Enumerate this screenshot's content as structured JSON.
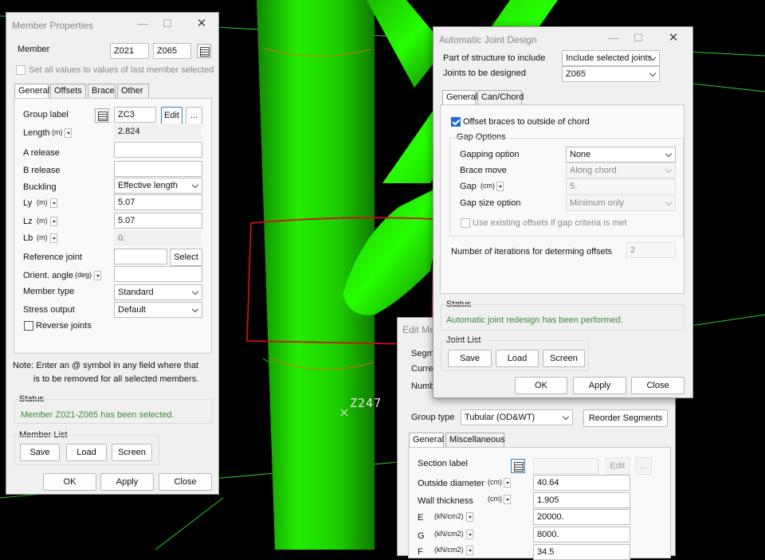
{
  "viewport": {
    "node_label": "Z247"
  },
  "member_properties": {
    "title": "Member Properties",
    "member_label": "Member",
    "member_from": "Z021",
    "member_to": "Z065",
    "set_all_label": "Set all values to values of last member selected",
    "tabs": [
      "General",
      "Offsets",
      "Brace",
      "Other"
    ],
    "group_label": "Group label",
    "group_value": "ZC3",
    "edit_label": "Edit",
    "more_label": "...",
    "length_label": "Length",
    "unit_m": "(m)",
    "unit_deg": "(deg)",
    "length_value": "2.824",
    "a_release": "A release",
    "b_release": "B release",
    "buckling_label": "Buckling",
    "buckling_value": "Effective length",
    "ly_label": "Ly",
    "ly_value": "5.07",
    "lz_label": "Lz",
    "lz_value": "5.07",
    "lb_label": "Lb",
    "lb_value": "0.",
    "ref_joint_label": "Reference joint",
    "select_label": "Select",
    "orient_label": "Orient. angle",
    "member_type_label": "Member type",
    "member_type_value": "Standard",
    "stress_output_label": "Stress output",
    "stress_output_value": "Default",
    "reverse_joints_label": "Reverse joints",
    "note_line1": "Note: Enter an @ symbol in any field where that",
    "note_line2": "is to be removed for all selected members.",
    "status_title": "Status",
    "status_text": "Member Z021-Z065 has been selected.",
    "member_list_title": "Member List",
    "save": "Save",
    "load": "Load",
    "screen": "Screen",
    "ok": "OK",
    "apply": "Apply",
    "close": "Close"
  },
  "edit_member": {
    "title_partial": "Edit Me",
    "seg_partial": "Segm",
    "curr_partial": "Curren",
    "numb_partial": "Numb",
    "group_type_label": "Group type",
    "group_type_value": "Tubular (OD&WT)",
    "reorder_label": "Reorder Segments",
    "tabs": [
      "General",
      "Miscellaneous"
    ],
    "section_label": "Section label",
    "edit_label": "Edit",
    "more_label": "...",
    "od_label": "Outside diameter",
    "od_unit": "(cm)",
    "od_value": "40.64",
    "wt_label": "Wall thickness",
    "wt_unit": "(cm)",
    "wt_value": "1.905",
    "e_label": "E",
    "e_unit": "(kN/cm2)",
    "e_value": "20000.",
    "g_label": "G",
    "g_unit": "(kN/cm2)",
    "g_value": "8000.",
    "f_label": "F",
    "f_unit": "(kN/cm2)",
    "f_value": "34.5"
  },
  "joint_design": {
    "title": "Automatic Joint Design",
    "part_label": "Part of structure to include",
    "part_value": "Include selected joints",
    "joints_label": "Joints to be designed",
    "joints_value": "Z065",
    "tabs": [
      "General",
      "Can/Chord"
    ],
    "offset_braces_label": "Offset braces to outside of chord",
    "gap_options_title": "Gap Options",
    "gapping_label": "Gapping option",
    "gapping_value": "None",
    "brace_move_label": "Brace move",
    "brace_move_value": "Along chord",
    "gap_label": "Gap",
    "gap_unit": "(cm)",
    "gap_value": "5.",
    "gap_size_label": "Gap size option",
    "gap_size_value": "Minimum only",
    "use_existing_label": "Use existing offsets if gap criteria is met",
    "iterations_label": "Number of iterations for determing offsets",
    "iterations_value": "2",
    "status_title": "Status",
    "status_text": "Automatic joint redesign has been performed.",
    "joint_list_title": "Joint List",
    "save": "Save",
    "load": "Load",
    "screen": "Screen",
    "ok": "OK",
    "apply": "Apply",
    "close": "Close"
  },
  "colors": {
    "member": "#22ee00",
    "highlight": "#cc1111",
    "grid": "#33dd33"
  }
}
